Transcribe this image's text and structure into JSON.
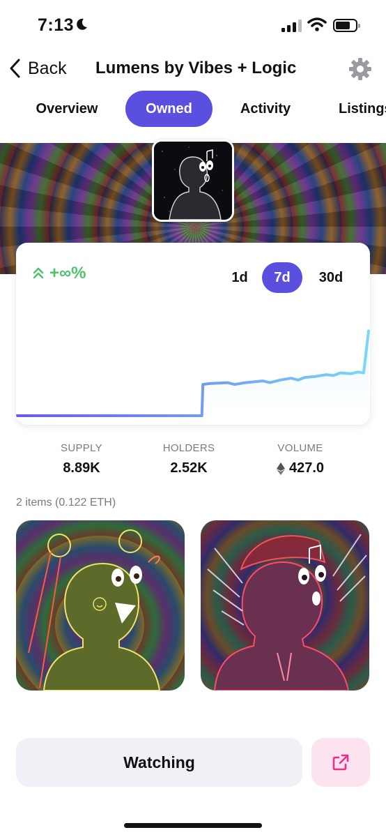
{
  "status_bar": {
    "time": "7:13",
    "icons": [
      "moon-icon",
      "signal-icon",
      "wifi-icon",
      "battery-icon"
    ]
  },
  "nav": {
    "back_label": "Back",
    "title": "Lumens by Vibes + Logic",
    "settings_icon": "gear-icon"
  },
  "tabs": [
    {
      "label": "Overview",
      "active": false
    },
    {
      "label": "Owned",
      "active": true
    },
    {
      "label": "Activity",
      "active": false
    },
    {
      "label": "Listings",
      "active": false
    }
  ],
  "chart_card": {
    "change": "+∞%",
    "change_color": "#4cc26a",
    "ranges": [
      {
        "label": "1d",
        "active": false
      },
      {
        "label": "7d",
        "active": true
      },
      {
        "label": "30d",
        "active": false
      }
    ]
  },
  "chart_data": {
    "type": "line",
    "title": "",
    "xlabel": "",
    "ylabel": "",
    "grid": false,
    "axes_visible": false,
    "ylim": [
      0,
      1
    ],
    "x": [
      0,
      5,
      10,
      15,
      20,
      25,
      30,
      35,
      40,
      45,
      50,
      52.7,
      53,
      55,
      60,
      62,
      65,
      70,
      72,
      75,
      78,
      80,
      82,
      85,
      88,
      90,
      92,
      95,
      97,
      98.6,
      100
    ],
    "values": [
      0,
      0,
      0,
      0,
      0,
      0,
      0,
      0,
      0,
      0,
      0,
      0,
      0.35,
      0.36,
      0.37,
      0.35,
      0.37,
      0.39,
      0.37,
      0.4,
      0.42,
      0.4,
      0.43,
      0.44,
      0.46,
      0.45,
      0.48,
      0.47,
      0.49,
      0.48,
      0.95
    ],
    "line_gradient": [
      "#6a5be8",
      "#7ad7f5"
    ]
  },
  "stats": [
    {
      "label": "SUPPLY",
      "value": "8.89K"
    },
    {
      "label": "HOLDERS",
      "value": "2.52K"
    },
    {
      "label": "VOLUME",
      "value": "427.0",
      "icon": "eth-icon"
    }
  ],
  "items_summary": "2 items (0.122 ETH)",
  "nfts": [
    {
      "name": "nft-lumen-green"
    },
    {
      "name": "nft-lumen-purple"
    }
  ],
  "actions": {
    "watch_label": "Watching",
    "share_icon": "share-icon",
    "share_color": "#e8308a"
  },
  "colors": {
    "accent": "#5b4fe0",
    "muted_text": "#7a7a80",
    "button_bg": "#f1f0f7",
    "share_bg": "#fde3ef"
  }
}
